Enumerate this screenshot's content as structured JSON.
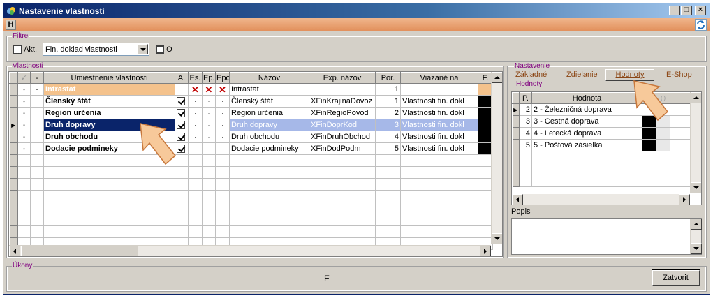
{
  "window": {
    "title": "Nastavenie vlastností",
    "h_label": "H"
  },
  "filters": {
    "label": "Filtre",
    "akt_label": "Akt.",
    "akt_checked": false,
    "combo_value": "Fin. doklad vlastnosti",
    "o_label": "O",
    "o_checked": false
  },
  "properties": {
    "label": "Vlastnosti",
    "columns": [
      "",
      "",
      "-",
      "Umiestnenie vlastnosti",
      "A.",
      "Es.",
      "Ep.",
      "Epo",
      "Názov",
      "Exp. názov",
      "Por.",
      "Viazané na",
      "F."
    ],
    "rows": [
      {
        "indicator": "",
        "c1": "◦",
        "c2": "-",
        "name": "Intrastat",
        "a": false,
        "es": "x",
        "ep": "x",
        "epo": "x",
        "nazov": "Intrastat",
        "exp": "",
        "por": "1",
        "viaz": "",
        "f": "orange"
      },
      {
        "indicator": "",
        "c1": "◦",
        "c2": "",
        "name": "Členský štát",
        "a": true,
        "es": "·",
        "ep": "·",
        "epo": "·",
        "nazov": "Členský štát",
        "exp": "XFinKrajinaDovoz",
        "por": "1",
        "viaz": "Vlastnosti fin. dokl",
        "f": "black"
      },
      {
        "indicator": "",
        "c1": "◦",
        "c2": "",
        "name": "Region určenia",
        "a": true,
        "es": "·",
        "ep": "·",
        "epo": "·",
        "nazov": "Region určenia",
        "exp": "XFinRegioPovod",
        "por": "2",
        "viaz": "Vlastnosti fin. dokl",
        "f": "black"
      },
      {
        "indicator": "▶",
        "c1": "◦",
        "c2": "",
        "name": "Druh dopravy",
        "a": true,
        "es": "·",
        "ep": "·",
        "epo": "·",
        "nazov": "Druh dopravy",
        "exp": "XFinDoprKod",
        "por": "3",
        "viaz": "Vlastnosti fin. dokl",
        "f": "black"
      },
      {
        "indicator": "",
        "c1": "◦",
        "c2": "",
        "name": "Druh obchodu",
        "a": true,
        "es": "·",
        "ep": "·",
        "epo": "·",
        "nazov": "Druh obchodu",
        "exp": "XFinDruhObchod",
        "por": "4",
        "viaz": "Vlastnosti fin. dokl",
        "f": "black"
      },
      {
        "indicator": "",
        "c1": "◦",
        "c2": "",
        "name": "Dodacie podmineky",
        "a": true,
        "es": "·",
        "ep": "·",
        "epo": "·",
        "nazov": "Dodacie podmineky",
        "exp": "XFinDodPodm",
        "por": "5",
        "viaz": "Vlastnosti fin. dokl",
        "f": "black"
      }
    ]
  },
  "settings": {
    "label": "Nastavenie",
    "tabs": [
      "Základné",
      "Zdielanie",
      "Hodnoty",
      "E-Shop"
    ],
    "active_tab": "Hodnoty",
    "values_label": "Hodnoty",
    "values_columns": [
      "P.",
      "Hodnota",
      "",
      "(i)"
    ],
    "values_rows": [
      {
        "ind": "▶",
        "p": "2",
        "hodnota": "2 - Železničná doprava"
      },
      {
        "ind": "",
        "p": "3",
        "hodnota": "3 - Cestná doprava"
      },
      {
        "ind": "",
        "p": "4",
        "hodnota": "4 - Letecká doprava"
      },
      {
        "ind": "",
        "p": "5",
        "hodnota": "5 - Poštová zásielka"
      }
    ],
    "popis_label": "Popis",
    "popis_value": ""
  },
  "actions": {
    "label": "Úkony",
    "center_text": "E",
    "close_label": "Zatvoriť"
  }
}
